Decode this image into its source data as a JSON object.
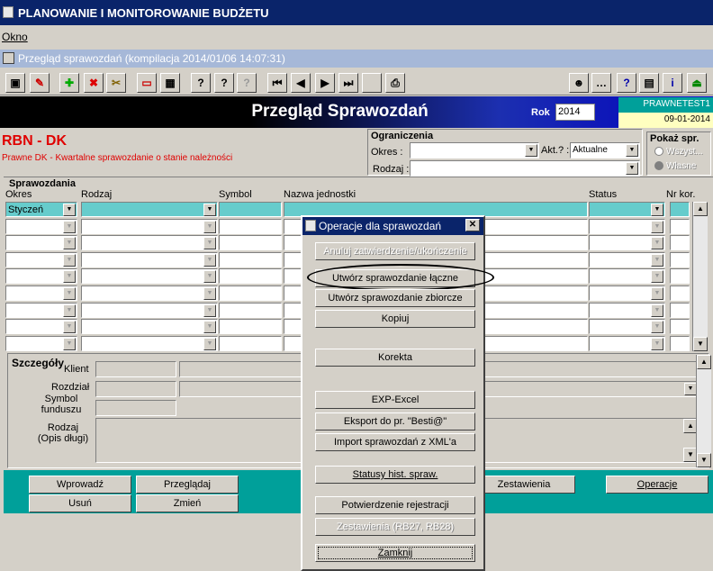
{
  "app_title": "PLANOWANIE I MONITOROWANIE BUDŻETU",
  "menu": {
    "okno": "Okno"
  },
  "window_subtitle": "Przegląd sprawozdań (kompilacja 2014/01/06 14:07:31)",
  "header": {
    "title": "Przegląd Sprawozdań",
    "rok_label": "Rok",
    "rok_value": "2014",
    "user": "PRAWNETEST1",
    "date": "09-01-2014"
  },
  "report": {
    "code": "RBN - DK",
    "description": "Prawne DK - Kwartalne sprawozdanie o stanie należności"
  },
  "ograniczenia": {
    "title": "Ograniczenia",
    "okres_label": "Okres :",
    "akt_label": "Akt.? :",
    "akt_value": "Aktualne",
    "rodzaj_label": "Rodzaj :"
  },
  "pokaz": {
    "title": "Pokaż spr.",
    "opt1": "Wszyst...",
    "opt2": "Własne"
  },
  "sprawozdania": {
    "title": "Sprawozdania",
    "col_okres": "Okres",
    "col_rodzaj": "Rodzaj",
    "col_symbol": "Symbol",
    "col_nazwa": "Nazwa jednostki",
    "col_status": "Status",
    "col_nrkor": "Nr kor.",
    "first_okres": "Styczeń"
  },
  "szczegoly": {
    "title": "Szczegóły",
    "klient": "Klient",
    "rozdzial": "Rozdział",
    "symbol_funduszu": "Symbol funduszu",
    "rodzaj": "Rodzaj (Opis długi)"
  },
  "bottom_buttons": {
    "wprowadz": "Wprowadź",
    "przegladaj": "Przeglądaj",
    "usun": "Usuń",
    "zmien": "Zmień",
    "zestawienia": "Zestawienia",
    "operacje": "Operacje"
  },
  "dialog": {
    "title": "Operacje dla sprawozdań",
    "anuluj": "Anuluj zatwierdzenie/ukończenie",
    "utworz_laczne": "Utwórz sprawozdanie łączne",
    "utworz_zbiorcze": "Utwórz sprawozdanie zbiorcze",
    "kopiuj": "Kopiuj",
    "korekta": "Korekta",
    "exp_excel": "EXP-Excel",
    "eksport": "Eksport do pr. \"Besti@\"",
    "import": "Import sprawozdań z XML'a",
    "statusy": "Statusy hist. spraw.",
    "potwierdzenie": "Potwierdzenie rejestracji",
    "zestawienia_rb": "Zestawienia (RB27, RB28)",
    "zamknij": "Zamknij"
  }
}
